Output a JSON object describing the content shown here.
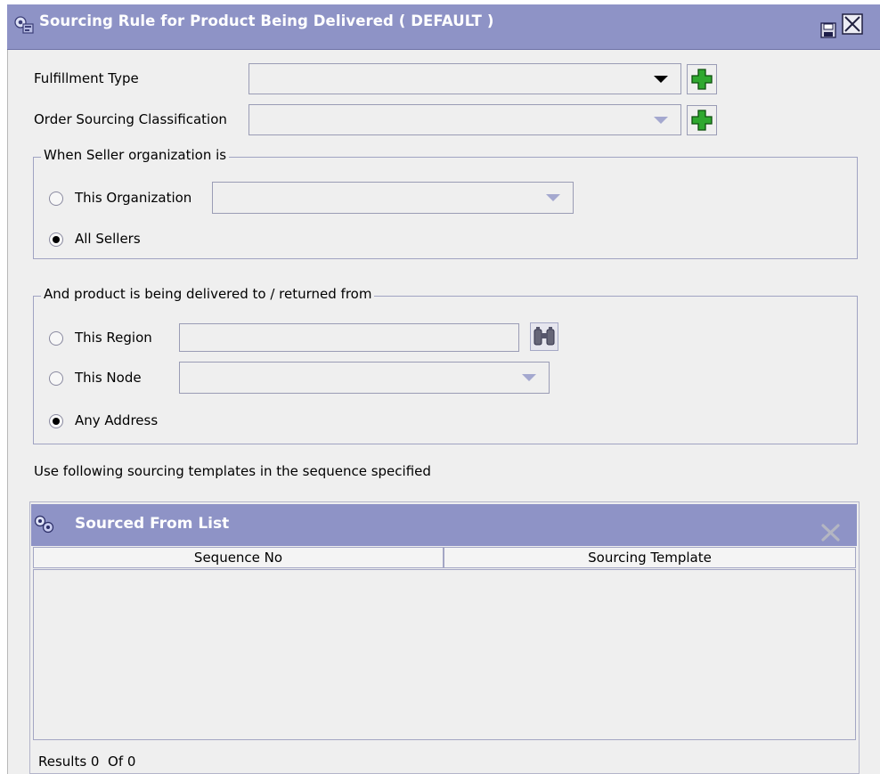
{
  "window": {
    "title": "Sourcing Rule for Product Being Delivered ( DEFAULT )",
    "title_icon": "sourcing-rule-icon",
    "save_icon": "save-disk-icon",
    "close_icon": "close-x-icon"
  },
  "form": {
    "fulfillment_type_label": "Fulfillment Type",
    "fulfillment_type_value": "",
    "order_sourcing_label": "Order Sourcing Classification",
    "order_sourcing_value": "",
    "add_icon": "green-plus-icon"
  },
  "seller_group": {
    "legend": "When Seller organization is",
    "this_org_label": "This Organization",
    "this_org_value": "",
    "all_sellers_label": "All Sellers",
    "selected": "All Sellers"
  },
  "delivery_group": {
    "legend": "And product is being delivered to / returned from",
    "this_region_label": "This Region",
    "this_region_value": "",
    "lookup_icon": "binoculars-icon",
    "this_node_label": "This Node",
    "this_node_value": "",
    "any_address_label": "Any Address",
    "selected": "Any Address"
  },
  "instructions": "Use following sourcing templates in the sequence specified",
  "sourced_list": {
    "title": "Sourced From List",
    "icon": "sourced-list-icon",
    "delete_icon": "delete-x-icon",
    "columns": [
      "Sequence No",
      "Sourcing Template"
    ],
    "rows": [],
    "results_text": "Results 0  Of 0"
  }
}
